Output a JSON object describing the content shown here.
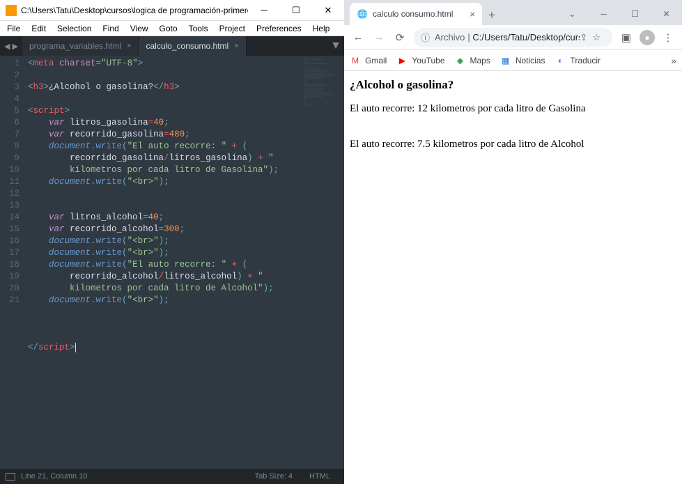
{
  "sublime": {
    "title": "C:\\Users\\Tatu\\Desktop\\cursos\\logica de programación-primeros pasos\\calc...",
    "menu": [
      "File",
      "Edit",
      "Selection",
      "Find",
      "View",
      "Goto",
      "Tools",
      "Project",
      "Preferences",
      "Help"
    ],
    "tabs": [
      {
        "label": "programa_variables.html",
        "active": false
      },
      {
        "label": "calculo_consumo.html",
        "active": true
      }
    ],
    "status": {
      "pos": "Line 21, Column 10",
      "tabsize": "Tab Size: 4",
      "lang": "HTML"
    },
    "lines": [
      "1",
      "2",
      "3",
      "4",
      "5",
      "6",
      "7",
      "8",
      "",
      "9",
      "10",
      "11",
      "12",
      "13",
      "14",
      "15",
      "16",
      "",
      "17",
      "18",
      "19",
      "20",
      "21"
    ],
    "code": {
      "l1_attr": "charset",
      "l1_val": "\"UTF-8\"",
      "l3_text": "¿Alcohol o gasolina?",
      "l6_var": "litros_gasolina",
      "l6_val": "40",
      "l7_var": "recorrido_gasolina",
      "l7_val": "480",
      "l8_str1": "\"El auto recorre: \"",
      "l8a_a": "recorrido_gasolina",
      "l8a_b": "litros_gasolina",
      "l8a_str": "\"",
      "l8b_str": "kilometros por cada litro de Gasolina\"",
      "br": "\"<br>\"",
      "l12_var": "litros_alcohol",
      "l12_val": "40",
      "l13_var": "recorrido_alcohol",
      "l13_val": "300",
      "l16a_a": "recorrido_alcohol",
      "l16a_b": "litros_alcohol",
      "l16b_str": "kilometros por cada litro de Alcohol\"",
      "meta": "meta",
      "h3o": "h3",
      "h3c": "h3",
      "script_o": "script",
      "script_c": "script",
      "var_kw": "var",
      "document": "document",
      "write": "write"
    }
  },
  "chrome": {
    "tab_title": "calculo consumo.html",
    "omnibox_label": "Archivo",
    "omnibox_url": "C:/Users/Tatu/Desktop/curso..",
    "bookmarks": [
      {
        "icon": "M",
        "color": "#ea4335",
        "label": "Gmail"
      },
      {
        "icon": "▶",
        "color": "#ff0000",
        "label": "YouTube"
      },
      {
        "icon": "◆",
        "color": "#34a853",
        "label": "Maps"
      },
      {
        "icon": "▦",
        "color": "#1a73e8",
        "label": "Noticias"
      },
      {
        "icon": "◐",
        "color": "#4285f4",
        "label": "Traducir"
      }
    ],
    "page": {
      "heading": "¿Alcohol o gasolina?",
      "line1": "El auto recorre: 12 kilometros por cada litro de Gasolina",
      "line2": "El auto recorre: 7.5 kilometros por cada litro de Alcohol"
    }
  }
}
